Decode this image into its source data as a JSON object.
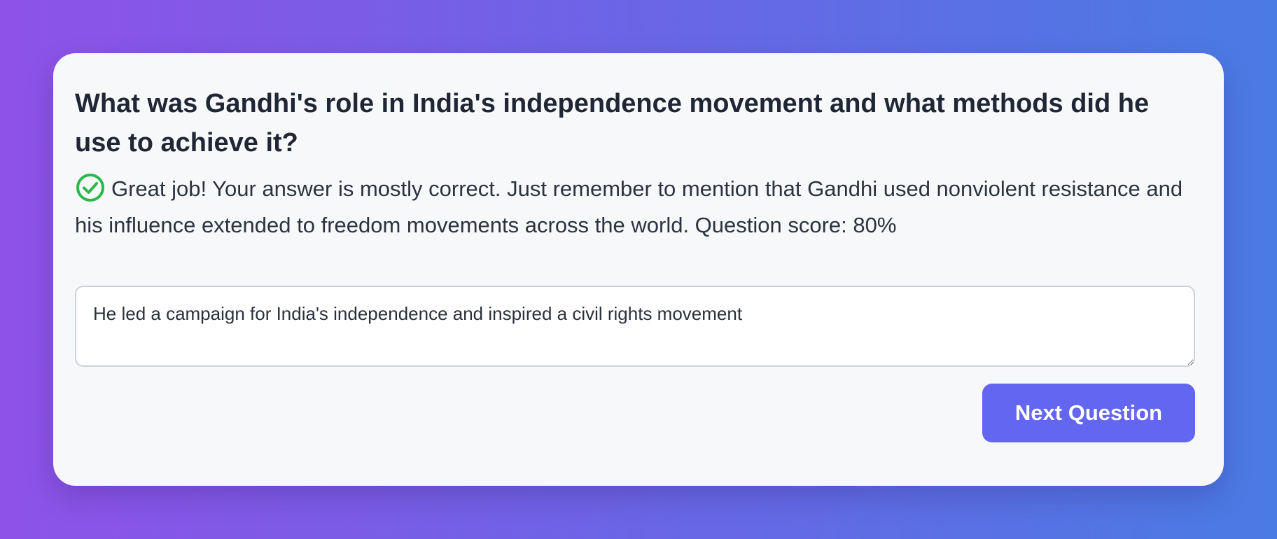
{
  "quiz": {
    "question": "What was Gandhi's role in India's independence movement and what methods did he use to achieve it?",
    "feedback": {
      "icon": "check-circle-icon",
      "icon_color": "#2bb84a",
      "text": "Great job! Your answer is mostly correct. Just remember to mention that Gandhi used nonviolent resistance and his influence extended to freedom movements across the world. Question score: 80%"
    },
    "answer_value": "He led a campaign for India's independence and inspired a civil rights movement",
    "next_button_label": "Next Question"
  },
  "colors": {
    "accent": "#6366f1",
    "success": "#2bb84a",
    "card_background": "#f7f8fa"
  }
}
